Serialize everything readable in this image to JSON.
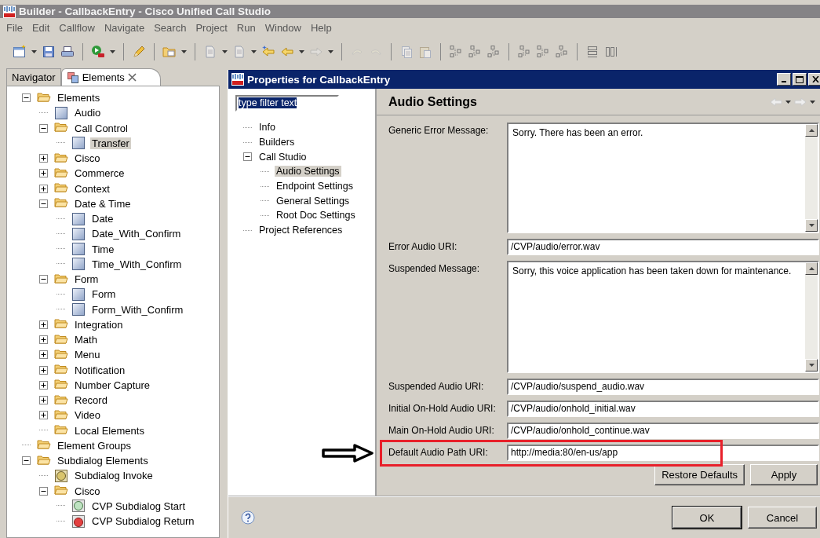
{
  "window": {
    "title": "Builder - CallbackEntry - Cisco Unified Call Studio"
  },
  "menu": [
    "File",
    "Edit",
    "Callflow",
    "Navigate",
    "Search",
    "Project",
    "Run",
    "Window",
    "Help"
  ],
  "panel_tabs": [
    {
      "label": "Navigator",
      "selected": false
    },
    {
      "label": "Elements",
      "selected": true
    }
  ],
  "element_tree": [
    {
      "label": "Elements",
      "kind": "folder",
      "expanded": true,
      "selected": false,
      "children": [
        {
          "label": "Audio",
          "kind": "element",
          "selected": false
        },
        {
          "label": "Call Control",
          "kind": "folder",
          "expanded": true,
          "selected": false,
          "children": [
            {
              "label": "Transfer",
              "kind": "element",
              "selected": true
            }
          ]
        },
        {
          "label": "Cisco",
          "kind": "folder",
          "expanded": false,
          "selected": false
        },
        {
          "label": "Commerce",
          "kind": "folder",
          "expanded": false,
          "selected": false
        },
        {
          "label": "Context",
          "kind": "folder",
          "expanded": false,
          "selected": false
        },
        {
          "label": "Date & Time",
          "kind": "folder",
          "expanded": true,
          "selected": false,
          "children": [
            {
              "label": "Date",
              "kind": "element",
              "selected": false
            },
            {
              "label": "Date_With_Confirm",
              "kind": "element",
              "selected": false
            },
            {
              "label": "Time",
              "kind": "element",
              "selected": false
            },
            {
              "label": "Time_With_Confirm",
              "kind": "element",
              "selected": false
            }
          ]
        },
        {
          "label": "Form",
          "kind": "folder",
          "expanded": true,
          "selected": false,
          "children": [
            {
              "label": "Form",
              "kind": "element",
              "selected": false
            },
            {
              "label": "Form_With_Confirm",
              "kind": "element",
              "selected": false
            }
          ]
        },
        {
          "label": "Integration",
          "kind": "folder",
          "expanded": false,
          "selected": false
        },
        {
          "label": "Math",
          "kind": "folder",
          "expanded": false,
          "selected": false
        },
        {
          "label": "Menu",
          "kind": "folder",
          "expanded": false,
          "selected": false
        },
        {
          "label": "Notification",
          "kind": "folder",
          "expanded": false,
          "selected": false
        },
        {
          "label": "Number Capture",
          "kind": "folder",
          "expanded": false,
          "selected": false
        },
        {
          "label": "Record",
          "kind": "folder",
          "expanded": false,
          "selected": false
        },
        {
          "label": "Video",
          "kind": "folder",
          "expanded": false,
          "selected": false
        },
        {
          "label": "Local Elements",
          "kind": "folder",
          "selected": false
        }
      ]
    },
    {
      "label": "Element Groups",
      "kind": "folder",
      "selected": false
    },
    {
      "label": "Subdialog Elements",
      "kind": "folder",
      "expanded": true,
      "selected": false,
      "children": [
        {
          "label": "Subdialog Invoke",
          "kind": "invoke",
          "selected": false
        },
        {
          "label": "Cisco",
          "kind": "folder",
          "expanded": true,
          "selected": false,
          "children": [
            {
              "label": "CVP Subdialog Start",
              "kind": "start",
              "selected": false
            },
            {
              "label": "CVP Subdialog Return",
              "kind": "return",
              "selected": false
            }
          ]
        }
      ]
    }
  ],
  "dialog": {
    "title": "Properties for CallbackEntry",
    "filter": {
      "value": "type filter text",
      "text_selected": true
    },
    "pages": [
      {
        "label": "Info",
        "selected": false
      },
      {
        "label": "Builders",
        "selected": false
      },
      {
        "label": "Call Studio",
        "expanded": true,
        "selected": false,
        "children": [
          {
            "label": "Audio Settings",
            "selected": true
          },
          {
            "label": "Endpoint Settings",
            "selected": false
          },
          {
            "label": "General Settings",
            "selected": false
          },
          {
            "label": "Root Doc Settings",
            "selected": false
          }
        ]
      },
      {
        "label": "Project References",
        "selected": false
      }
    ],
    "page_title": "Audio Settings",
    "fields": [
      {
        "label": "Generic Error Message:",
        "value": "Sorry. There has been an error.",
        "kind": "textarea",
        "highlighted": false
      },
      {
        "label": "Error Audio URI:",
        "value": "/CVP/audio/error.wav",
        "kind": "text",
        "highlighted": false
      },
      {
        "label": "Suspended Message:",
        "value": "Sorry, this voice application has been taken down for maintenance.",
        "kind": "textarea",
        "highlighted": false
      },
      {
        "label": "Suspended Audio URI:",
        "value": "/CVP/audio/suspend_audio.wav",
        "kind": "text",
        "highlighted": false
      },
      {
        "label": "Initial On-Hold Audio URI:",
        "value": "/CVP/audio/onhold_initial.wav",
        "kind": "text",
        "highlighted": false
      },
      {
        "label": "Main On-Hold Audio URI:",
        "value": "/CVP/audio/onhold_continue.wav",
        "kind": "text",
        "highlighted": false
      },
      {
        "label": "Default Audio Path URI:",
        "value": "http://media:80/en-us/app",
        "kind": "text",
        "highlighted": true
      }
    ],
    "buttons": [
      {
        "label": "Restore Defaults"
      },
      {
        "label": "Apply"
      }
    ],
    "footer_buttons": [
      {
        "label": "OK",
        "default": true
      },
      {
        "label": "Cancel",
        "default": false
      }
    ]
  }
}
